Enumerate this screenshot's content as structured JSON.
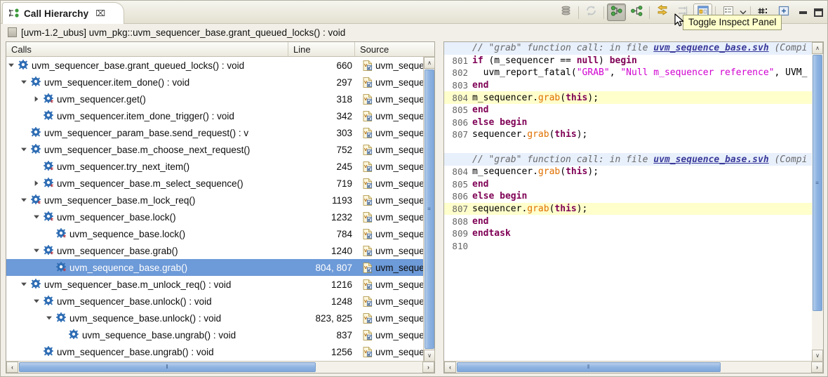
{
  "window": {
    "tab_title": "Call Hierarchy",
    "tab_icon": "call-hierarchy-icon",
    "close_glyph": "⌧"
  },
  "toolbar": {
    "buttons": [
      {
        "name": "collapse-all-button",
        "icon": "collapse-all-icon",
        "state": "normal",
        "enabled": true
      },
      {
        "name": "refresh-button",
        "icon": "refresh-icon",
        "state": "normal",
        "enabled": false
      },
      {
        "name": "show-callers-button",
        "icon": "show-callers-icon",
        "state": "pressed",
        "enabled": true
      },
      {
        "name": "show-callees-button",
        "icon": "show-callees-icon",
        "state": "normal",
        "enabled": true
      },
      {
        "name": "previous-hierarchy-button",
        "icon": "history-arrows-icon",
        "state": "normal",
        "enabled": true
      },
      {
        "name": "pin-view-button",
        "icon": "pin-icon",
        "state": "normal",
        "enabled": false
      },
      {
        "name": "toggle-inspect-panel-button",
        "icon": "inspect-panel-icon",
        "state": "framed",
        "enabled": true
      },
      {
        "name": "layout-menu-button",
        "icon": "layout-list-icon",
        "state": "normal",
        "enabled": true
      },
      {
        "name": "layout-dropdown-arrow",
        "icon": "chevron-down-icon",
        "state": "normal",
        "enabled": true
      },
      {
        "name": "filters-button",
        "icon": "filters-hash-icon",
        "state": "normal",
        "enabled": true
      },
      {
        "name": "maximize-view-button",
        "icon": "maximize-view-icon",
        "state": "normal",
        "enabled": true
      }
    ],
    "minimize_label": "minimize-icon",
    "maximize_label": "maximize-icon"
  },
  "tooltip": {
    "text": "Toggle Inspect Panel"
  },
  "header": {
    "icon": "root-element-icon",
    "text": "[uvm-1.2_ubus] uvm_pkg::uvm_sequencer_base.grant_queued_locks() : void"
  },
  "tree": {
    "columns": [
      {
        "key": "calls",
        "label": "Calls"
      },
      {
        "key": "line",
        "label": "Line"
      },
      {
        "key": "source",
        "label": "Source"
      }
    ],
    "rows": [
      {
        "depth": 0,
        "twisty": "open",
        "label": "uvm_sequencer_base.grant_queued_locks() : void",
        "line": "660",
        "source": "uvm_seque",
        "selected": false,
        "icon": "method-icon"
      },
      {
        "depth": 1,
        "twisty": "open",
        "label": "uvm_sequencer.item_done() : void",
        "line": "297",
        "source": "uvm_seque",
        "selected": false,
        "icon": "method-icon"
      },
      {
        "depth": 2,
        "twisty": "closed",
        "label": "uvm_sequencer.get()",
        "line": "318",
        "source": "uvm_seque",
        "selected": false,
        "icon": "method-task-icon"
      },
      {
        "depth": 2,
        "twisty": "none",
        "label": "uvm_sequencer.item_done_trigger() : void",
        "line": "342",
        "source": "uvm_seque",
        "selected": false,
        "icon": "method-icon"
      },
      {
        "depth": 1,
        "twisty": "none",
        "label": "uvm_sequencer_param_base.send_request() : v",
        "line": "303",
        "source": "uvm_seque",
        "selected": false,
        "icon": "method-icon"
      },
      {
        "depth": 1,
        "twisty": "open",
        "label": "uvm_sequencer_base.m_choose_next_request()",
        "line": "752",
        "source": "uvm_seque",
        "selected": false,
        "icon": "method-icon"
      },
      {
        "depth": 2,
        "twisty": "none",
        "label": "uvm_sequencer.try_next_item()",
        "line": "245",
        "source": "uvm_seque",
        "selected": false,
        "icon": "method-task-icon"
      },
      {
        "depth": 2,
        "twisty": "closed",
        "label": "uvm_sequencer_base.m_select_sequence()",
        "line": "719",
        "source": "uvm_seque",
        "selected": false,
        "icon": "method-task-icon"
      },
      {
        "depth": 1,
        "twisty": "open",
        "label": "uvm_sequencer_base.m_lock_req()",
        "line": "1193",
        "source": "uvm_seque",
        "selected": false,
        "icon": "method-task-icon"
      },
      {
        "depth": 2,
        "twisty": "open",
        "label": "uvm_sequencer_base.lock()",
        "line": "1232",
        "source": "uvm_seque",
        "selected": false,
        "icon": "method-task-icon"
      },
      {
        "depth": 3,
        "twisty": "none",
        "label": "uvm_sequence_base.lock()",
        "line": "784",
        "source": "uvm_seque",
        "selected": false,
        "icon": "method-task-icon"
      },
      {
        "depth": 2,
        "twisty": "open",
        "label": "uvm_sequencer_base.grab()",
        "line": "1240",
        "source": "uvm_seque",
        "selected": false,
        "icon": "method-task-icon"
      },
      {
        "depth": 3,
        "twisty": "none",
        "label": "uvm_sequence_base.grab()",
        "line": "804, 807",
        "source": "uvm_seque",
        "selected": true,
        "icon": "method-task-icon"
      },
      {
        "depth": 1,
        "twisty": "open",
        "label": "uvm_sequencer_base.m_unlock_req() : void",
        "line": "1216",
        "source": "uvm_seque",
        "selected": false,
        "icon": "method-icon"
      },
      {
        "depth": 2,
        "twisty": "open",
        "label": "uvm_sequencer_base.unlock() : void",
        "line": "1248",
        "source": "uvm_seque",
        "selected": false,
        "icon": "method-icon"
      },
      {
        "depth": 3,
        "twisty": "open",
        "label": "uvm_sequence_base.unlock() : void",
        "line": "823, 825",
        "source": "uvm_seque",
        "selected": false,
        "icon": "method-icon"
      },
      {
        "depth": 4,
        "twisty": "none",
        "label": "uvm_sequence_base.ungrab() : void",
        "line": "837",
        "source": "uvm_seque",
        "selected": false,
        "icon": "method-icon"
      },
      {
        "depth": 2,
        "twisty": "none",
        "label": "uvm_sequencer_base.ungrab() : void",
        "line": "1256",
        "source": "uvm_seque",
        "selected": false,
        "icon": "method-icon"
      }
    ]
  },
  "inspect_panel": {
    "blocks": [
      {
        "comment": {
          "pre": "// \"grab\" function call: in file ",
          "link": "uvm_sequence_base.svh",
          "post": " (Compi"
        },
        "lines": [
          {
            "no": "801",
            "highlight": false,
            "tokens": [
              {
                "t": "if ",
                "c": "k"
              },
              {
                "t": "(m_sequencer == ",
                "c": "pl"
              },
              {
                "t": "null",
                "c": "k"
              },
              {
                "t": ") ",
                "c": "pl"
              },
              {
                "t": "begin",
                "c": "k"
              }
            ]
          },
          {
            "no": "802",
            "highlight": false,
            "tokens": [
              {
                "t": "  uvm_report_fatal(",
                "c": "pl"
              },
              {
                "t": "\"GRAB\"",
                "c": "str"
              },
              {
                "t": ", ",
                "c": "pl"
              },
              {
                "t": "\"Null m_sequencer reference\"",
                "c": "str"
              },
              {
                "t": ", UVM_",
                "c": "pl"
              }
            ]
          },
          {
            "no": "803",
            "highlight": false,
            "tokens": [
              {
                "t": "end",
                "c": "k"
              }
            ]
          },
          {
            "no": "804",
            "highlight": true,
            "tokens": [
              {
                "t": "m_sequencer.",
                "c": "pl"
              },
              {
                "t": "grab",
                "c": "fn"
              },
              {
                "t": "(",
                "c": "pl"
              },
              {
                "t": "this",
                "c": "k"
              },
              {
                "t": ");",
                "c": "pl"
              }
            ]
          },
          {
            "no": "805",
            "highlight": false,
            "tokens": [
              {
                "t": "end",
                "c": "k"
              }
            ]
          },
          {
            "no": "806",
            "highlight": false,
            "tokens": [
              {
                "t": "else begin",
                "c": "k"
              }
            ]
          },
          {
            "no": "807",
            "highlight": false,
            "tokens": [
              {
                "t": "sequencer.",
                "c": "pl"
              },
              {
                "t": "grab",
                "c": "fn"
              },
              {
                "t": "(",
                "c": "pl"
              },
              {
                "t": "this",
                "c": "k"
              },
              {
                "t": ");",
                "c": "pl"
              }
            ]
          }
        ]
      },
      {
        "comment": {
          "pre": "// \"grab\" function call: in file ",
          "link": "uvm_sequence_base.svh",
          "post": " (Compi"
        },
        "lines": [
          {
            "no": "804",
            "highlight": false,
            "tokens": [
              {
                "t": "m_sequencer.",
                "c": "pl"
              },
              {
                "t": "grab",
                "c": "fn"
              },
              {
                "t": "(",
                "c": "pl"
              },
              {
                "t": "this",
                "c": "k"
              },
              {
                "t": ");",
                "c": "pl"
              }
            ]
          },
          {
            "no": "805",
            "highlight": false,
            "tokens": [
              {
                "t": "end",
                "c": "k"
              }
            ]
          },
          {
            "no": "806",
            "highlight": false,
            "tokens": [
              {
                "t": "else begin",
                "c": "k"
              }
            ]
          },
          {
            "no": "807",
            "highlight": true,
            "tokens": [
              {
                "t": "sequencer.",
                "c": "pl"
              },
              {
                "t": "grab",
                "c": "fn"
              },
              {
                "t": "(",
                "c": "pl"
              },
              {
                "t": "this",
                "c": "k"
              },
              {
                "t": ");",
                "c": "pl"
              }
            ]
          },
          {
            "no": "808",
            "highlight": false,
            "tokens": [
              {
                "t": "end",
                "c": "k"
              }
            ]
          },
          {
            "no": "809",
            "highlight": false,
            "tokens": [
              {
                "t": "endtask",
                "c": "k"
              }
            ]
          },
          {
            "no": "810",
            "highlight": false,
            "tokens": []
          }
        ]
      }
    ]
  },
  "scrollbars": {
    "tree_vertical": {
      "up": "∧",
      "down": "∨",
      "grip": "≡"
    },
    "tree_horizontal": {
      "left": "‹",
      "right": "›",
      "grip": "‖"
    },
    "code_vertical": {
      "up": "∧",
      "down": "∨",
      "grip": "≡"
    },
    "code_horizontal": {
      "left": "‹",
      "right": "›",
      "grip": "‖"
    }
  },
  "colors": {
    "selection_blue": "#6d9ad8",
    "highlight_yellow": "#ffffcc",
    "comment_band": "#e8f0fc",
    "chrome": "#f1efe7"
  }
}
